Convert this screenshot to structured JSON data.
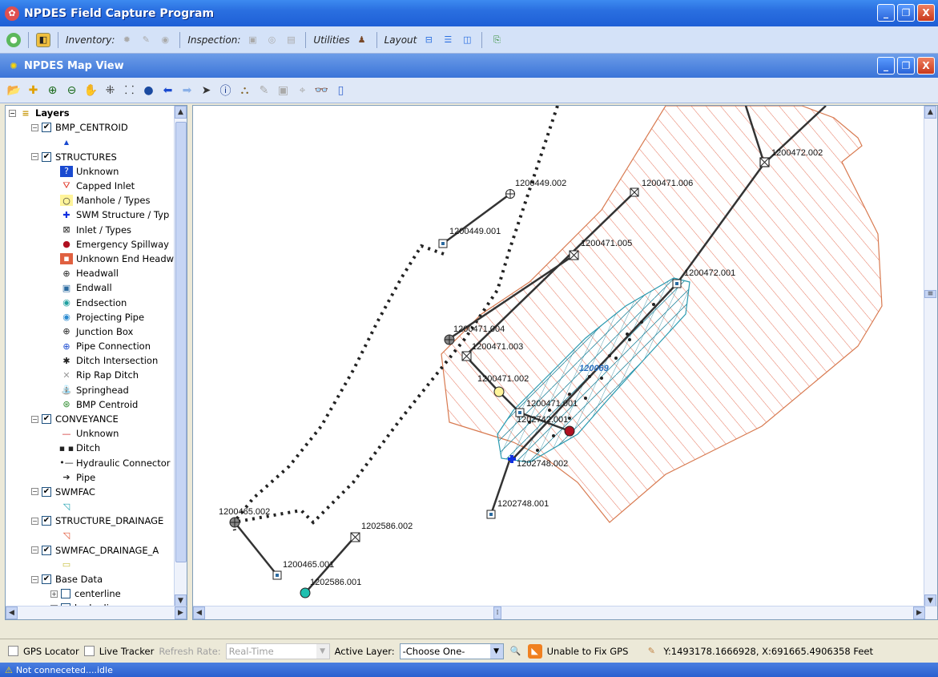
{
  "app": {
    "title": "NPDES Field Capture Program",
    "min": "_",
    "restore": "❐",
    "close": "X"
  },
  "toolbar": {
    "inventory": "Inventory:",
    "inspection": "Inspection:",
    "utilities": "Utilities",
    "layout": "Layout"
  },
  "mapview": {
    "title": "NPDES Map View"
  },
  "layers": {
    "header": "Layers",
    "rows": [
      {
        "label": "BMP_CENTROID",
        "kind": "group"
      },
      {
        "label": "STRUCTURES",
        "kind": "group"
      },
      {
        "label": "Unknown",
        "kind": "item",
        "icon": "question-icon"
      },
      {
        "label": "Capped Inlet",
        "kind": "item",
        "icon": "capped-inlet-icon"
      },
      {
        "label": "Manhole / Types",
        "kind": "item",
        "icon": "manhole-icon"
      },
      {
        "label": "SWM Structure / Typ",
        "kind": "item",
        "icon": "swm-cross-icon"
      },
      {
        "label": "Inlet / Types",
        "kind": "item",
        "icon": "inlet-icon"
      },
      {
        "label": "Emergency Spillway",
        "kind": "item",
        "icon": "spillway-icon"
      },
      {
        "label": "Unknown End Headw",
        "kind": "item",
        "icon": "end-headwall-icon"
      },
      {
        "label": "Headwall",
        "kind": "item",
        "icon": "headwall-icon"
      },
      {
        "label": "Endwall",
        "kind": "item",
        "icon": "endwall-icon"
      },
      {
        "label": "Endsection",
        "kind": "item",
        "icon": "endsection-icon"
      },
      {
        "label": "Projecting Pipe",
        "kind": "item",
        "icon": "projecting-pipe-icon"
      },
      {
        "label": "Junction Box",
        "kind": "item",
        "icon": "junction-box-icon"
      },
      {
        "label": "Pipe Connection",
        "kind": "item",
        "icon": "pipe-connection-icon"
      },
      {
        "label": "Ditch Intersection",
        "kind": "item",
        "icon": "ditch-intersection-icon"
      },
      {
        "label": "Rip Rap Ditch",
        "kind": "item",
        "icon": "rip-rap-icon"
      },
      {
        "label": "Springhead",
        "kind": "item",
        "icon": "springhead-icon"
      },
      {
        "label": "BMP Centroid",
        "kind": "item",
        "icon": "bmp-centroid-icon"
      },
      {
        "label": "CONVEYANCE",
        "kind": "group"
      },
      {
        "label": "Unknown",
        "kind": "item",
        "icon": "line-unknown-icon"
      },
      {
        "label": "Ditch",
        "kind": "item",
        "icon": "line-ditch-icon"
      },
      {
        "label": "Hydraulic Connector",
        "kind": "item",
        "icon": "line-hydraulic-icon"
      },
      {
        "label": "Pipe",
        "kind": "item",
        "icon": "line-pipe-icon"
      },
      {
        "label": "SWMFAC",
        "kind": "group"
      },
      {
        "label": "",
        "kind": "item",
        "icon": "swmfac-hatch-icon"
      },
      {
        "label": "STRUCTURE_DRAINAGE",
        "kind": "group"
      },
      {
        "label": "",
        "kind": "item",
        "icon": "drainage-hatch-icon"
      },
      {
        "label": "SWMFAC_DRAINAGE_A",
        "kind": "group"
      },
      {
        "label": "",
        "kind": "item",
        "icon": "swmfac-drainage-icon"
      },
      {
        "label": "Base Data",
        "kind": "group"
      },
      {
        "label": "centerline",
        "kind": "sub"
      },
      {
        "label": "hydro line",
        "kind": "sub"
      }
    ]
  },
  "map_labels": [
    "1200472.002",
    "1200449.002",
    "1200471.006",
    "1200449.001",
    "1200471.005",
    "1200472.001",
    "1200471.004",
    "1200471.003",
    "120069",
    "1200471.002",
    "1200471.001",
    "1202742.001",
    "1202748.002",
    "1202748.001",
    "1200465.002",
    "1202586.002",
    "1200465.001",
    "1202586.001"
  ],
  "status": {
    "gps_locator": "GPS Locator",
    "live_tracker": "Live Tracker",
    "refresh_rate": "Refresh Rate:",
    "refresh_value": "Real-Time",
    "active_layer": "Active Layer:",
    "active_layer_value": "-Choose One-",
    "gps_status": "Unable to Fix GPS",
    "coords": "Y:1493178.1666928, X:691665.4906358  Feet"
  },
  "bottom": {
    "conn": "Not conneceted....idle"
  }
}
